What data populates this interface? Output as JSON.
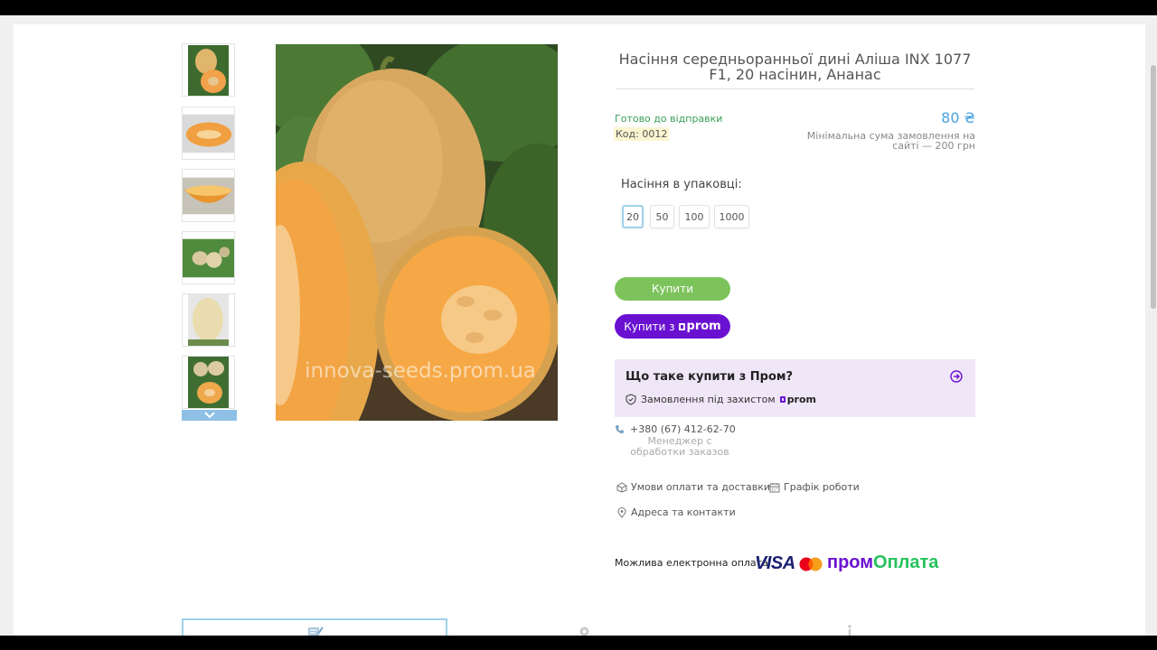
{
  "product": {
    "title": "Насіння середньоранньої дині Аліша INX 1077 F1, 20 насінин, Ананас",
    "status": "Готово до відправки",
    "code": "Код: 0012",
    "price": "80 ₴",
    "min_order": "Мінімальна сума замовлення на сайті — 200 грн",
    "watermark": "innova-seeds.prom.ua"
  },
  "options": {
    "label": "Насіння в упаковці:",
    "items": [
      "20",
      "50",
      "100",
      "1000"
    ],
    "selected": "20"
  },
  "buttons": {
    "buy": "Купити",
    "buy_prom_prefix": "Купити з",
    "prom_logo": "prom"
  },
  "prom_info": {
    "title": "Що таке купити з Пром?",
    "protection": "Замовлення під захистом",
    "logo": "prom"
  },
  "contact": {
    "phone": "+380 (67) 412-62-70",
    "manager": "Менеджер с обработки заказов"
  },
  "links": {
    "payment_delivery": "Умови оплати та доставки",
    "schedule": "Графік роботи",
    "address": "Адреса та контакти"
  },
  "payment": {
    "label": "Можлива електронна оплата",
    "visa": "VISA",
    "prom_pay_1": "пром",
    "prom_pay_2": "Оплата"
  },
  "colors": {
    "accent_green": "#7dc35b",
    "prom_purple": "#6a11d1",
    "price_blue": "#4aa3df"
  }
}
